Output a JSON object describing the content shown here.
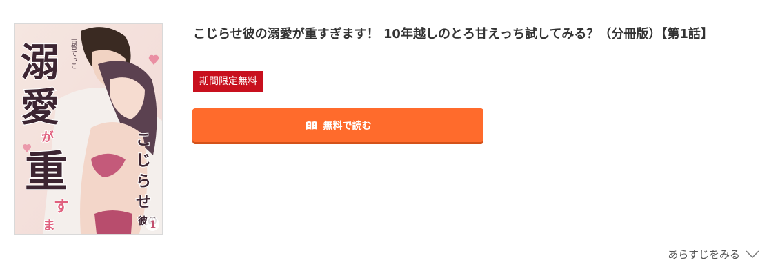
{
  "book": {
    "title": "こじらせ彼の溺愛が重すぎます！ 10年越しのとろ甘えっち試してみる？（分冊版）【第1話】",
    "badge": "期間限定無料",
    "read_button_label": "無料で読む",
    "synopsis_link": "あらすじをみる"
  },
  "cover": {
    "title_text": "溺愛が重すぎます",
    "title_text_2": "こじらせ彼の",
    "author": "古賀てっこ",
    "volume_number": "1"
  },
  "colors": {
    "badge_bg": "#c8101e",
    "button_bg": "#ff6b2c",
    "text": "#333333"
  },
  "icons": {
    "read_button": "book-icon",
    "synopsis": "chevron-down-icon"
  }
}
